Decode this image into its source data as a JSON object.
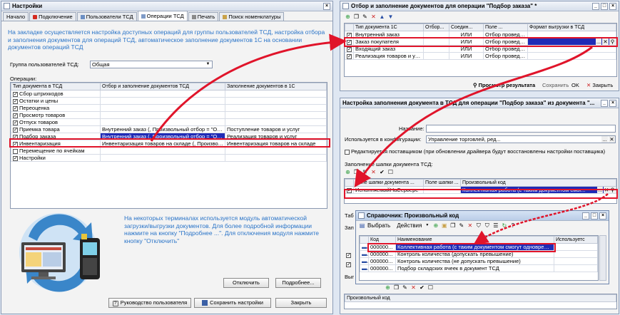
{
  "main": {
    "title": "Настройки",
    "tabs": [
      "Начало",
      "Подключение",
      "Пользователи ТСД",
      "Операции ТСД",
      "Печать",
      "Поиск номенклатуры"
    ],
    "info_text": "На закладке осуществляется настройка доступных операций для группы пользователей ТСД, настройка отбора и заполнения документов для операций ТСД, автоматическое заполнение документов 1С на основании документов операций ТСД",
    "group_label": "Группа пользователей ТСД:",
    "group_value": "Общая",
    "ops_label": "Операции:",
    "columns": [
      "Тип документа в ТСД",
      "Отбор и заполнение документов ТСД",
      "Заполнение документов в 1С"
    ],
    "rows": [
      {
        "name": "Сбор штрихкодов",
        "filter": "",
        "fill": ""
      },
      {
        "name": "Остатки и цены",
        "filter": "",
        "fill": ""
      },
      {
        "name": "Переоценка",
        "filter": "",
        "fill": ""
      },
      {
        "name": "Просмотр товаров",
        "filter": "",
        "fill": ""
      },
      {
        "name": "Отпуск товаров",
        "filter": "",
        "fill": ""
      },
      {
        "name": "Приемка товара",
        "filter": "Внутренний заказ (, Произвольный отбор = \"От...",
        "fill": "Поступление товаров и услуг"
      },
      {
        "name": "Подбор заказа",
        "filter": "Внутренний заказ (, Произвольный отбор = \"От...",
        "fill": "Реализация товаров и услуг"
      },
      {
        "name": "Инвентаризация",
        "filter": "Инвентаризация товаров на складе (, Произвол...",
        "fill": "Инвентаризация товаров на складе"
      },
      {
        "name": "Перемещение по ячейкам",
        "filter": "",
        "fill": ""
      },
      {
        "name": "Настройки",
        "filter": "",
        "fill": ""
      }
    ],
    "bottom_text": "На некоторых терминалах используется модуль автоматической загрузки/выгрузки документов. Для более подробной информации нажмите на кнопку \"Подробнее ...\". Для отключения модуля нажмите кнопку \"Отключить\"",
    "btn_disable": "Отключить",
    "btn_more": "Подробнее...",
    "btn_manual": "Руководство пользователя",
    "btn_save": "Сохранить настройки",
    "btn_close": "Закрыть"
  },
  "filter_win": {
    "title": "Отбор и заполнение документов для операции \"Подбор заказа\" *",
    "columns": [
      "Тип документа 1С",
      "Отбор...",
      "Соедин...",
      "Поле ...",
      "Формат выгрузки в ТСД"
    ],
    "rows": [
      {
        "name": "Внутренний заказ",
        "a": "",
        "b": "ИЛИ",
        "c": "Отбор проведе...",
        "d": ""
      },
      {
        "name": "Заказ покупателя",
        "a": "",
        "b": "ИЛИ",
        "c": "Отбор проведе...",
        "d": ""
      },
      {
        "name": "Входящий заказ",
        "a": "",
        "b": "ИЛИ",
        "c": "Отбор проведе...",
        "d": ""
      },
      {
        "name": "Реализация товаров и услуг",
        "a": "",
        "b": "ИЛИ",
        "c": "Отбор проведе...",
        "d": ""
      }
    ],
    "preview": "Просмотр результата",
    "save": "Сохранить",
    "ok": "OK",
    "close": "Закрыть"
  },
  "fill_win": {
    "title": "Настройка заполнения документа в ТСД для операции \"Подбор заказа\" из документа \"...",
    "name_label": "Название:",
    "name_value": "",
    "config_label": "Используется в конфигурации:",
    "config_value": "Управление торговлей, ред...",
    "edit_label": "Редактируется поставщиком (при обновлении драйвера будут восстановлены настройки поставщика)",
    "header_label": "Заполнение шапки документа ТСД:",
    "columns": [
      "Поле шапки документа ...",
      "Поле шапки ...",
      "Произвольный код"
    ],
    "row": {
      "a": "ИсполняемыйНаСервере",
      "b": "",
      "c": "Коллективная работа (с таким документом смог..."
    },
    "tab_fragment": "Таб",
    "zap_fragment": "Зап",
    "vyg_fragment": "Выг",
    "bottom_col": "Произвольный код"
  },
  "ref_win": {
    "title": "Справочник: Произвольный код",
    "select": "Выбрать",
    "actions": "Действия",
    "columns": [
      "Код",
      "Наименование",
      "Используетс"
    ],
    "rows": [
      {
        "code": "000000...",
        "name": "Коллективная работа (с таким документом смогут одновреме..."
      },
      {
        "code": "000000...",
        "name": "Контроль количества (допускать превышение)"
      },
      {
        "code": "000000...",
        "name": "Контроль количества (не допускать превышение)"
      },
      {
        "code": "000000...",
        "name": "Подбор складских ячеек в документ ТСД"
      }
    ]
  }
}
